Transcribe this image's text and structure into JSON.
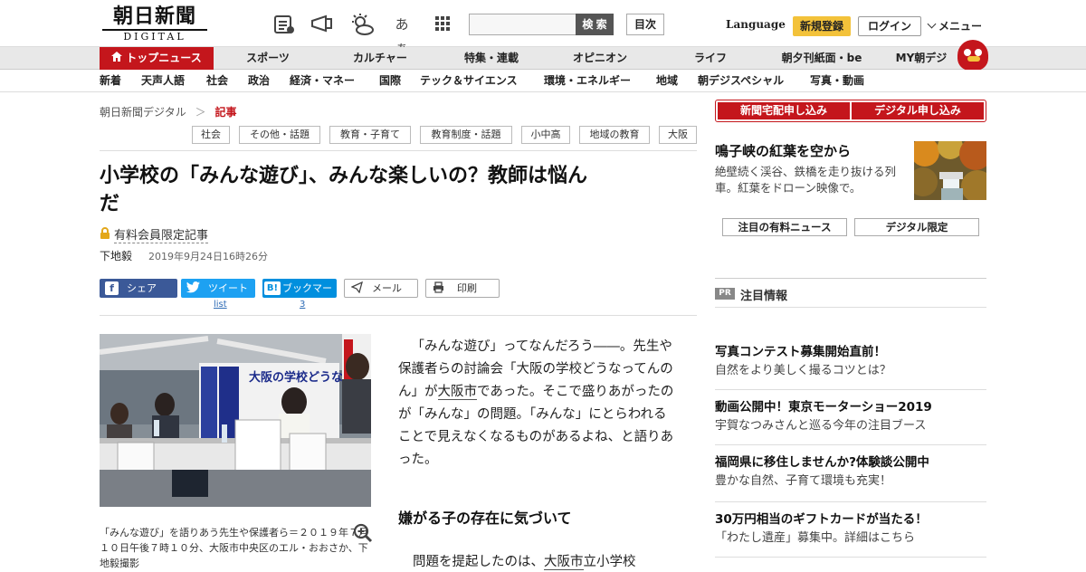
{
  "header": {
    "logo_jp": "朝日新聞",
    "logo_en": "DIGITAL",
    "icons": [
      "newspaper-icon",
      "megaphone-icon",
      "weather-icon",
      "font-size-icon",
      "grid-icon"
    ],
    "font_size_glyph": "あぁ",
    "search_button": "検 索",
    "toc_button": "目次",
    "language": "Language",
    "register": "新規登録",
    "login": "ログイン",
    "menu": "メニュー",
    "accent_color": "#c4161c"
  },
  "nav_main": [
    "トップニュース",
    "スポーツ",
    "カルチャー",
    "特集・連載",
    "オピニオン",
    "ライフ",
    "朝夕刊紙面・be",
    "MY朝デジ"
  ],
  "nav_sub": [
    "新着",
    "天声人語",
    "社会",
    "政治",
    "経済・マネー",
    "国際",
    "テック＆サイエンス",
    "環境・エネルギー",
    "地域",
    "朝デジスペシャル",
    "写真・動画"
  ],
  "breadcrumb": {
    "home": "朝日新聞デジタル",
    "sep": "＞",
    "current": "記事"
  },
  "tags": [
    "社会",
    "その他・話題",
    "教育・子育て",
    "教育制度・話題",
    "小中高",
    "地域の教育",
    "大阪"
  ],
  "article": {
    "title_line1": "小学校の「みんな遊び」、みんな楽しいの？教師は悩ん",
    "title_line2": "だ",
    "paid_label": "有料会員限定記事",
    "author": "下地毅",
    "date": "2019年9月24日16時26分",
    "share": {
      "facebook": "シェア",
      "twitter": "ツイート",
      "twitter_count": "list",
      "hatena": "ブックマーク",
      "hatena_icon": "B!",
      "hatena_count": "3",
      "mail": "メール",
      "print": "印刷"
    },
    "photo_caption": "「みんな遊び」を語りあう先生や保護者ら＝２０１９年７月１０日午後７時１０分、大阪市中央区のエル・おおさか、下地毅撮影",
    "photo_banner_text": "大阪の学校どうなってんの?!",
    "para1_a": "「みんな遊び」ってなんだろう――。先生や保護者らの討論会「大阪の学校どうなってんのん」が",
    "para1_link": "大阪市",
    "para1_b": "であった。そこで盛りあがったのが「みんな」の問題。「みんな」にとらわれることで見えなくなるものがあるよね、と語りあった。",
    "subheading": "嫌がる子の存在に気づいて",
    "para2_a": "問題を提起したのは、",
    "para2_link": "大阪市",
    "para2_b": "立小学校"
  },
  "sidebar": {
    "subscribe_paper": "新聞宅配申し込み",
    "subscribe_digital": "デジタル申し込み",
    "feature_title": "鳴子峡の紅葉を空から",
    "feature_desc": "絶壁続く渓谷、鉄橋を走り抜ける列車。紅葉をドローン映像で。",
    "tab_paid_news": "注目の有料ニュース",
    "tab_digital_only": "デジタル限定",
    "pr_badge": "PR",
    "pr_heading": "注目情報",
    "pr_items": [
      {
        "title": "写真コンテスト募集開始直前！",
        "desc": "自然をより美しく撮るコツとは？"
      },
      {
        "title": "動画公開中！東京モーターショー2019",
        "desc": "宇賀なつみさんと巡る今年の注目ブース"
      },
      {
        "title": "福岡県に移住しませんか?体験談公開中",
        "desc": "豊かな自然、子育て環境も充実！"
      },
      {
        "title": "30万円相当のギフトカードが当たる！",
        "desc": "「わたし遺産」募集中。詳細はこちら"
      }
    ]
  }
}
